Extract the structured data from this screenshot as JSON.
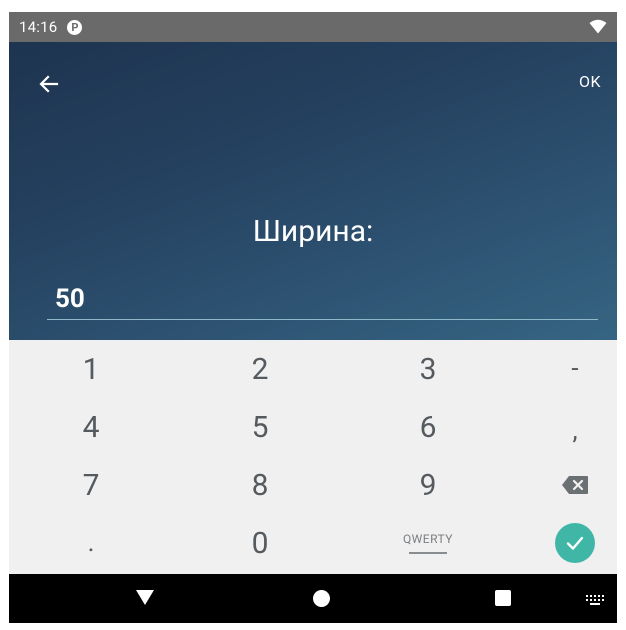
{
  "status_bar": {
    "time": "14:16",
    "notification_icon": "p-icon",
    "connectivity_icon": "wifi-icon"
  },
  "header": {
    "back_icon": "arrow-left-icon",
    "ok_label": "OK",
    "prompt": "Ширина:",
    "value": "50",
    "accent_color": "#8fb9c8"
  },
  "keypad": {
    "rows": [
      [
        "1",
        "2",
        "3",
        "-"
      ],
      [
        "4",
        "5",
        "6",
        ","
      ],
      [
        "7",
        "8",
        "9",
        "backspace-icon"
      ],
      [
        ".",
        "0",
        "QWERTY",
        "check-icon"
      ]
    ],
    "done_color": "#3fb6a6"
  },
  "nav_bar": {
    "back_icon": "triangle-back-icon",
    "home_icon": "circle-home-icon",
    "recents_icon": "square-recents-icon",
    "keyboard_icon": "keyboard-icon"
  }
}
